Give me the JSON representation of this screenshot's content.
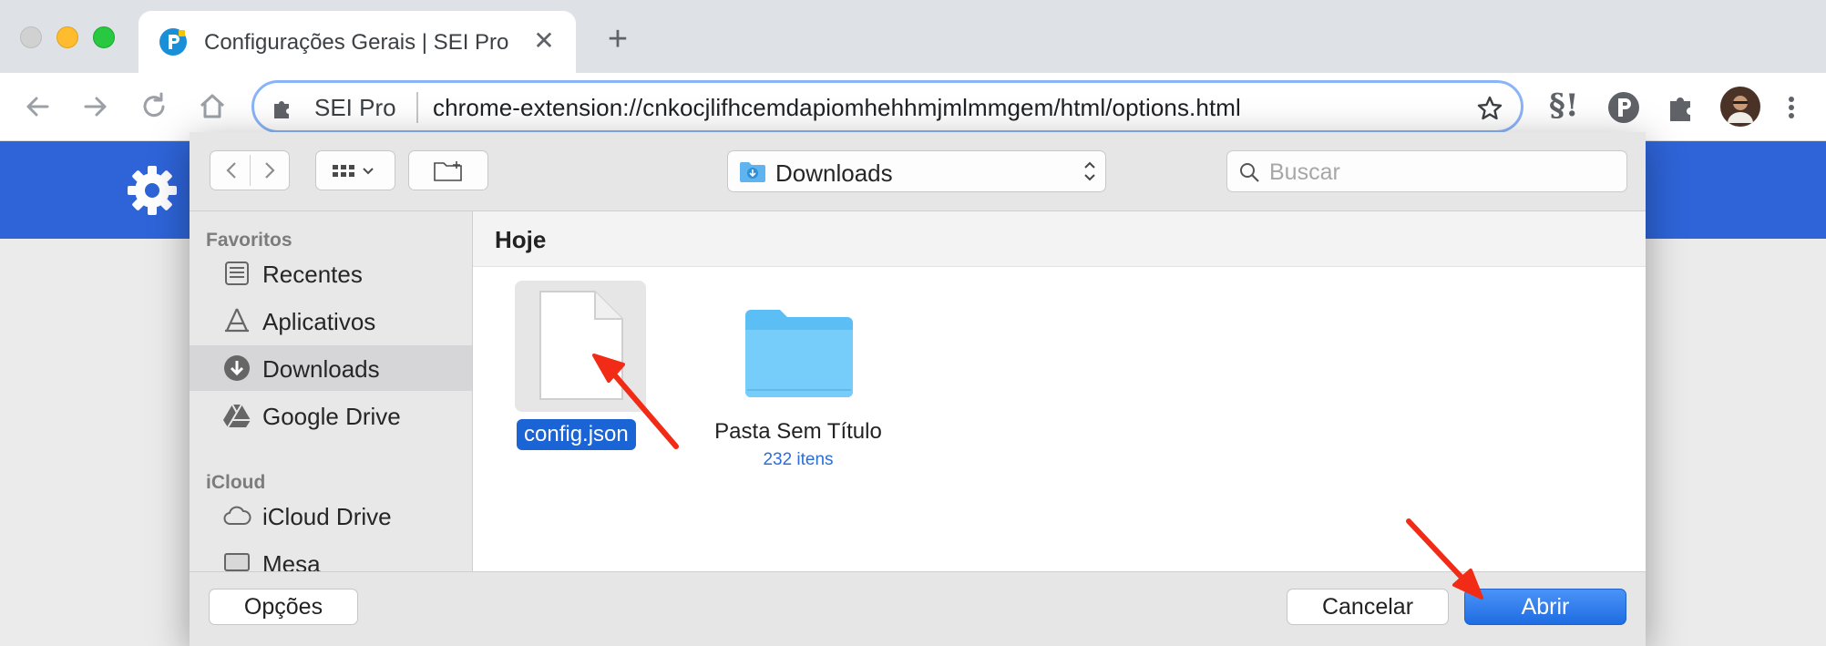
{
  "browser": {
    "tab": {
      "title": "Configurações Gerais | SEI Pro",
      "close_glyph": "✕"
    },
    "new_tab_glyph": "+",
    "omnibox": {
      "chip": "SEI Pro",
      "url": "chrome-extension://cnkocjlifhcemdapiomhehhmjmlmmgem/html/options.html"
    },
    "extensions": [
      "sei-pro-legal-icon",
      "sei-pro-icon",
      "puzzle-icon",
      "profile-avatar",
      "menu-icon"
    ],
    "legal_ext_label": "§!",
    "colors": {
      "banner": "#2e64d8",
      "accent": "#1a64d6",
      "annotation": "#f22b17"
    }
  },
  "dialog": {
    "location": "Downloads",
    "search_placeholder": "Buscar",
    "sidebar": {
      "favorites_title": "Favoritos",
      "favorites": [
        {
          "label": "Recentes",
          "icon": "recents-icon"
        },
        {
          "label": "Aplicativos",
          "icon": "applications-icon"
        },
        {
          "label": "Downloads",
          "icon": "downloads-icon",
          "selected": true
        },
        {
          "label": "Google Drive",
          "icon": "google-drive-icon"
        }
      ],
      "icloud_title": "iCloud",
      "icloud": [
        {
          "label": "iCloud Drive",
          "icon": "cloud-icon"
        },
        {
          "label": "Mesa",
          "icon": "desktop-icon"
        }
      ]
    },
    "group_title": "Hoje",
    "files": [
      {
        "name": "config.json",
        "kind": "file",
        "selected": true
      },
      {
        "name": "Pasta Sem Título",
        "kind": "folder",
        "count": "232 itens"
      }
    ],
    "footer": {
      "options": "Opções",
      "cancel": "Cancelar",
      "open": "Abrir"
    }
  }
}
